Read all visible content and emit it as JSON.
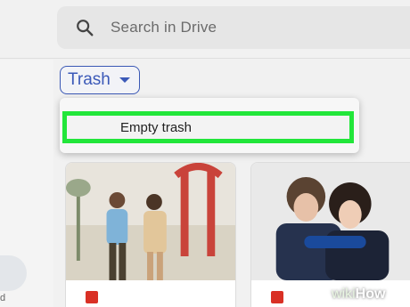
{
  "search": {
    "placeholder": "Search in Drive",
    "icon": "search-icon"
  },
  "breadcrumb": {
    "label": "Trash",
    "icon": "chevron-down-icon"
  },
  "menu": {
    "items": [
      {
        "label": "Empty trash",
        "highlight_color": "#22e63a"
      }
    ]
  },
  "files": [
    {
      "thumbnail": "wedding-photo",
      "name": "",
      "icon_color": "#d93025"
    },
    {
      "thumbnail": "couple-photo",
      "name": "",
      "icon_color": "#d93025"
    }
  ],
  "sidebar": {
    "truncated_text": "d"
  },
  "watermark": {
    "wiki": "wiki",
    "how": "How"
  },
  "colors": {
    "accent": "#3b59b8",
    "background": "#f1f1f1"
  }
}
